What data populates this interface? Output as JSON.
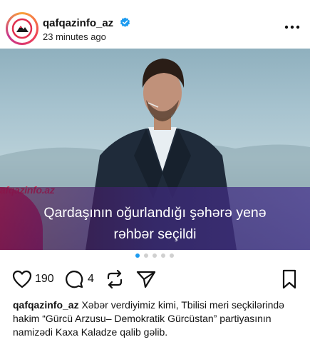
{
  "post": {
    "username": "qafqazinfo_az",
    "timestamp": "23 minutes ago",
    "verified_color": "#1d9bf0",
    "image": {
      "watermark": "afqazinfo.az",
      "headline_line1": "Qardaşının oğurlandığı şəhərə yenə",
      "headline_line2": "rəhbər seçildi"
    },
    "carousel": {
      "total": 5,
      "active_index": 0
    },
    "likes": "190",
    "comments": "4",
    "caption": {
      "username": "qafqazinfo_az",
      "text": "Xəbər verdiyimiz kimi, Tbilisi meri seçkilərində hakim “Gürcü Arzusu– Demokratik Gürcüstan” partiyasının namizədi Kaxa Kaladze qalib gəlib."
    }
  },
  "icons": {
    "more": "more-horizontal-icon",
    "like": "heart-icon",
    "comment": "comment-icon",
    "repost": "repost-icon",
    "share": "send-icon",
    "save": "bookmark-icon"
  },
  "colors": {
    "brand_red": "#e0304f",
    "overlay_purple": "#3c2878"
  }
}
